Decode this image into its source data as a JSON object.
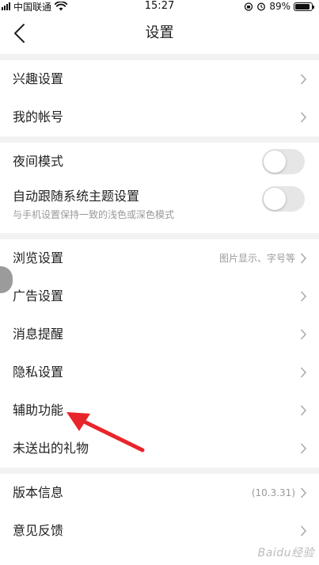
{
  "status_bar": {
    "carrier": "中国联通",
    "time": "15:27",
    "battery_percent": "89%",
    "battery_level": 0.89,
    "wifi_icon": "wifi-icon",
    "alarm_icon": "alarm-icon"
  },
  "nav": {
    "title": "设置",
    "back_icon": "back-chevron-icon"
  },
  "groups": [
    {
      "rows": [
        {
          "label": "兴趣设置"
        },
        {
          "label": "我的帐号"
        }
      ]
    },
    {
      "rows": [
        {
          "label": "夜间模式",
          "toggle": false
        },
        {
          "label": "自动跟随系统主题设置",
          "subtitle": "与手机设置保持一致的浅色或深色模式",
          "toggle": false
        }
      ]
    },
    {
      "rows": [
        {
          "label": "浏览设置",
          "value": "图片显示、字号等"
        },
        {
          "label": "广告设置"
        },
        {
          "label": "消息提醒"
        },
        {
          "label": "隐私设置"
        },
        {
          "label": "辅助功能"
        },
        {
          "label": "未送出的礼物"
        }
      ]
    },
    {
      "rows": [
        {
          "label": "版本信息",
          "value": "(10.3.31)"
        },
        {
          "label": "意见反馈"
        }
      ]
    }
  ],
  "watermark": "Baidu经验",
  "colors": {
    "separator": "#f2f2f2",
    "toggle_off": "#e6e6e6",
    "annotation_arrow": "#e8252a",
    "secondary_text": "#999999"
  }
}
